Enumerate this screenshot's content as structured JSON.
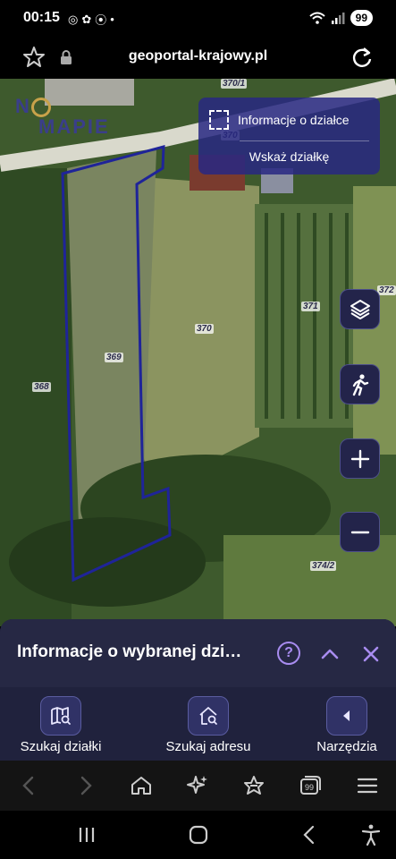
{
  "status": {
    "time": "00:15",
    "battery": "99"
  },
  "browser": {
    "url": "geoportal-krajowy.pl"
  },
  "map": {
    "logo_part1": "N",
    "logo_part2": "MAPIE",
    "info_panel": {
      "parcel_info_label": "Informacje o działce",
      "point_parcel_label": "Wskaż działkę"
    },
    "parcel_labels": [
      "369",
      "370",
      "368",
      "371",
      "372",
      "374/2",
      "370",
      "370/1"
    ],
    "colors": {
      "parcel_outline": "#1f2499",
      "ui_accent": "#a88cf0",
      "panel_bg": "#262844"
    }
  },
  "sheet": {
    "title": "Informacje o wybranej dzi…",
    "help_icon": "?",
    "tools": [
      {
        "label": "Szukaj działki",
        "icon": "map-search-icon"
      },
      {
        "label": "Szukaj adresu",
        "icon": "home-search-icon"
      },
      {
        "label": "Narzędzia",
        "icon": "caret-left-icon"
      }
    ]
  }
}
